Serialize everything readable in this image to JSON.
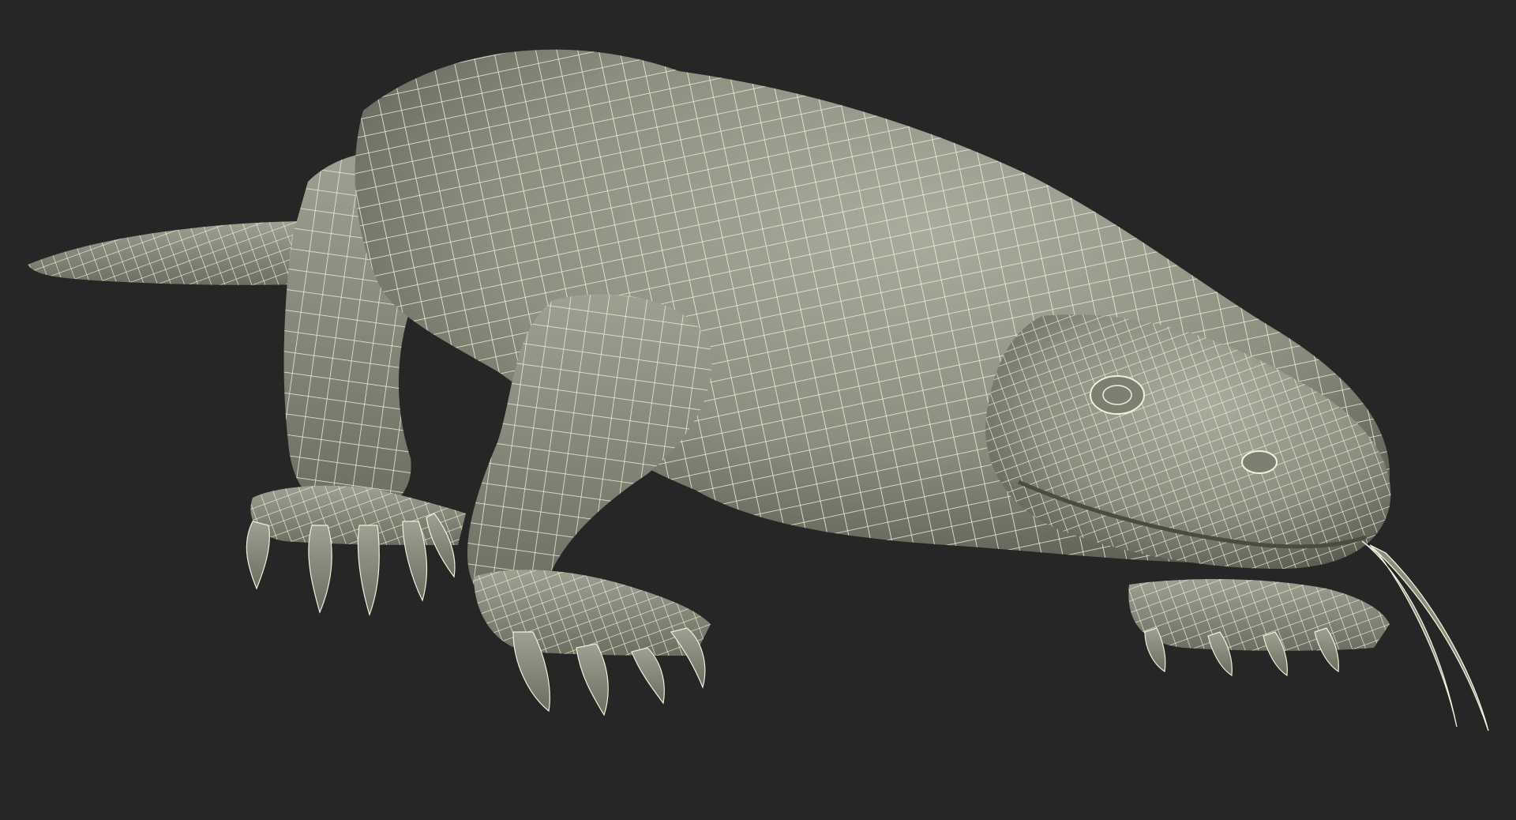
{
  "scene": {
    "subject": "komodo-dragon-wireframe-model",
    "colors": {
      "background": "#262626",
      "surface_light": "#a9ab9c",
      "surface_mid": "#8c8e7f",
      "surface_dark": "#5a5c50",
      "wire": "#f2f0dc"
    }
  }
}
